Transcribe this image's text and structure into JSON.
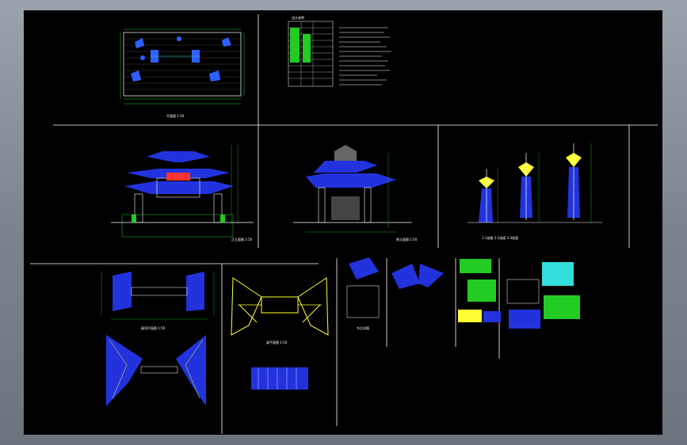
{
  "colors": {
    "frame": "#8a939b",
    "canvas": "#000000",
    "line": "#ffffff",
    "roof": "#2233dd",
    "accent_green": "#22cc22",
    "accent_yellow": "#ffff33",
    "accent_cyan": "#33dddd",
    "accent_red": "#ff3333"
  },
  "sheets": [
    {
      "name": "plan-layout",
      "label": "平面图 1:50"
    },
    {
      "name": "notes-table",
      "label": "设计说明"
    },
    {
      "name": "front-elevation",
      "label": "正立面图 1:50"
    },
    {
      "name": "side-elevation",
      "label": "侧立面图 1:50"
    },
    {
      "name": "sections",
      "label": "1-1剖面 2-2剖面 3-3剖面"
    },
    {
      "name": "roof-plans",
      "label": "屋顶平面图 1:50"
    },
    {
      "name": "beam-plan",
      "label": "梁平面图 1:50"
    },
    {
      "name": "details",
      "label": "节点详图"
    }
  ]
}
